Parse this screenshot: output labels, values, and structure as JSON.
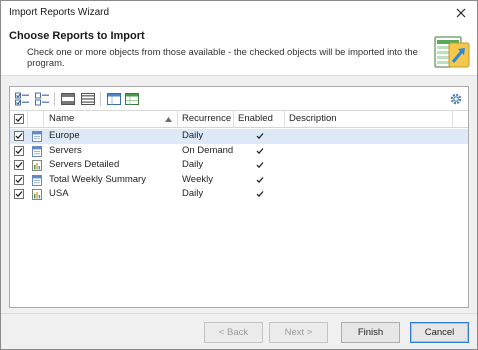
{
  "window": {
    "title": "Import Reports Wizard"
  },
  "header": {
    "heading": "Choose Reports to Import",
    "description": "Check one or more objects from those available - the checked objects will be imported into the program."
  },
  "toolbar": {
    "icons": [
      "check-all-icon",
      "uncheck-all-icon",
      "group-rows-icon",
      "ungroup-rows-icon",
      "expand-columns-icon",
      "collapse-columns-icon",
      "settings-icon"
    ]
  },
  "table": {
    "columns": {
      "name": "Name",
      "recurrence": "Recurrence",
      "enabled": "Enabled",
      "description": "Description"
    },
    "rows": [
      {
        "name": "Europe",
        "recurrence": "Daily",
        "checked": true,
        "enabled": true,
        "description": ""
      },
      {
        "name": "Servers",
        "recurrence": "On Demand",
        "checked": true,
        "enabled": true,
        "description": ""
      },
      {
        "name": "Servers Detailed",
        "recurrence": "Daily",
        "checked": true,
        "enabled": true,
        "description": ""
      },
      {
        "name": "Total Weekly Summary",
        "recurrence": "Weekly",
        "checked": true,
        "enabled": true,
        "description": ""
      },
      {
        "name": "USA",
        "recurrence": "Daily",
        "checked": true,
        "enabled": true,
        "description": ""
      }
    ]
  },
  "footer": {
    "back_label": "< Back",
    "next_label": "Next >",
    "finish_label": "Finish",
    "cancel_label": "Cancel"
  },
  "colors": {
    "selected_row": "#dde9f6",
    "accent_border": "#2f7bd2"
  }
}
